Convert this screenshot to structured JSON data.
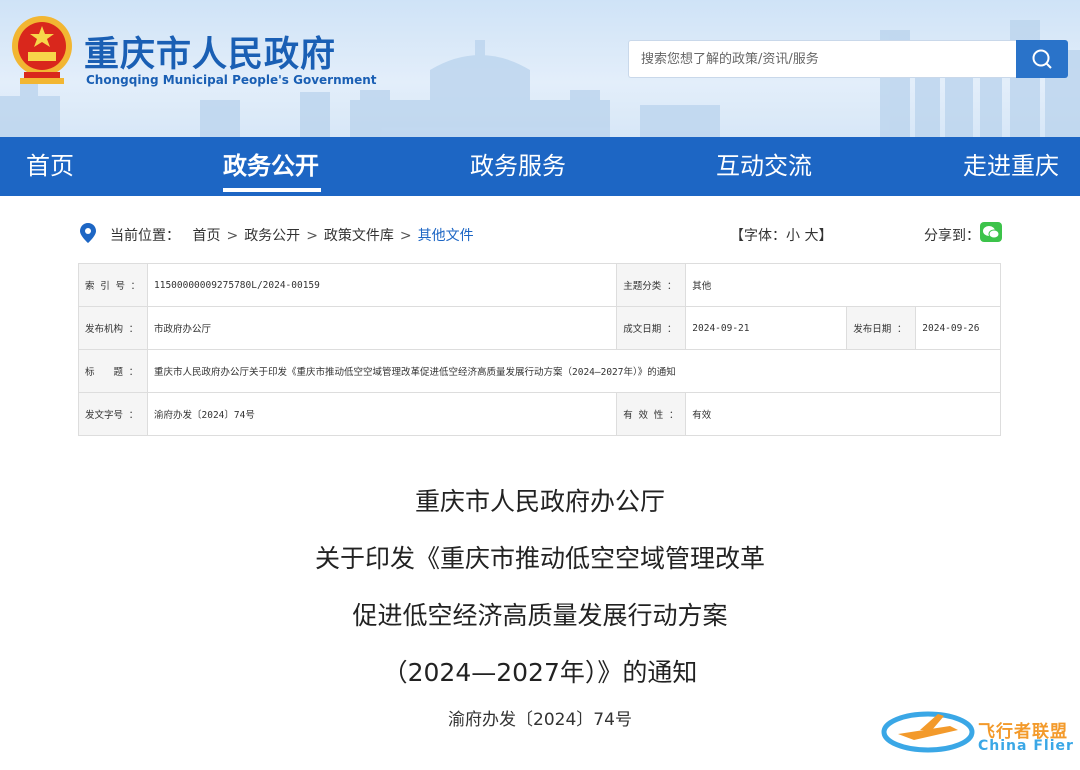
{
  "header": {
    "title": "重庆市人民政府",
    "subtitle": "Chongqing Municipal People's Government",
    "search_placeholder": "搜索您想了解的政策/资讯/服务"
  },
  "nav": {
    "items": [
      "首页",
      "政务公开",
      "政务服务",
      "互动交流",
      "走进重庆"
    ],
    "active_index": 1
  },
  "breadcrumb": {
    "label": "当前位置：",
    "items": [
      "首页",
      "政务公开",
      "政策文件库",
      "其他文件"
    ],
    "separator": ">"
  },
  "font_size": {
    "open": "【字体：",
    "small": "小",
    "large": "大",
    "close": "】"
  },
  "share": {
    "label": "分享到："
  },
  "info": {
    "index_label": "索 引 号 ：",
    "index_value": "11500000009275780L/2024-00159",
    "topic_label": "主题分类 ：",
    "topic_value": "其他",
    "issuer_label": "发布机构 ：",
    "issuer_value": "市政府办公厅",
    "written_label": "成文日期 ：",
    "written_value": "2024-09-21",
    "published_label": "发布日期 ：",
    "published_value": "2024-09-26",
    "title_label": "标　　题 ：",
    "title_value": "重庆市人民政府办公厅关于印发《重庆市推动低空空域管理改革促进低空经济高质量发展行动方案（2024—2027年）》的通知",
    "docno_label": "发文字号 ：",
    "docno_value": "渝府办发〔2024〕74号",
    "validity_label": "有 效 性 ：",
    "validity_value": "有效"
  },
  "article": {
    "title_lines": [
      "重庆市人民政府办公厅",
      "关于印发《重庆市推动低空空域管理改革",
      "促进低空经济高质量发展行动方案",
      "（2024—2027年）》的通知"
    ],
    "doc_number": "渝府办发〔2024〕74号"
  },
  "watermark": {
    "cn": "飞行者联盟",
    "en": "China Flier"
  },
  "colors": {
    "brand_blue": "#1d66c4",
    "title_blue": "#1a5fb4",
    "wechat_green": "#3cc34a"
  }
}
